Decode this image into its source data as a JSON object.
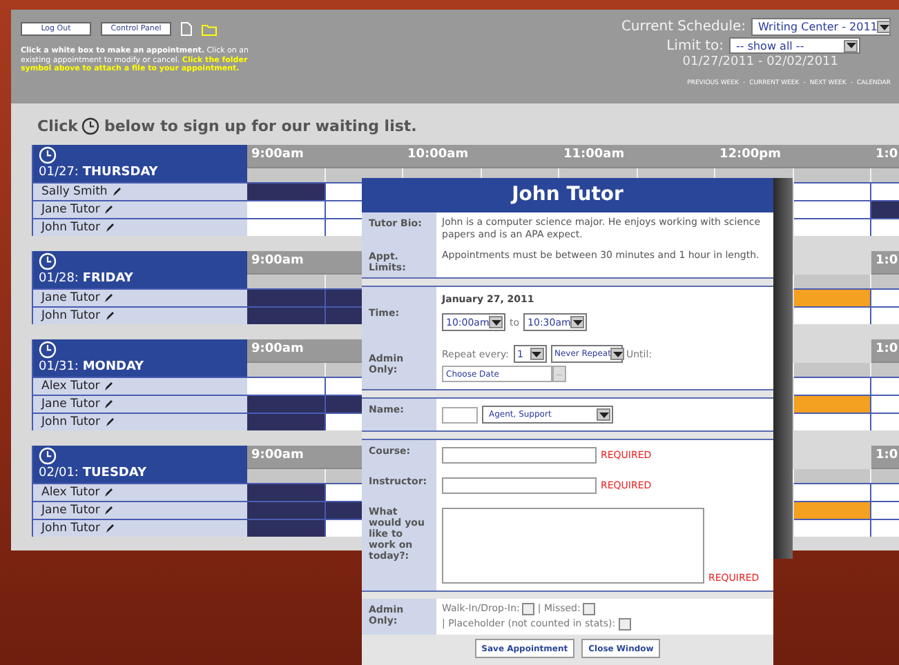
{
  "header": {
    "buttons": [
      "Log Out",
      "Control Panel"
    ],
    "instructions": "**Click a white box to make an appointment.** Click on an existing appointment to modify or cancel. **Click the folder symbol above to attach a file to your appointment.**",
    "schedule_label": "Current Schedule:",
    "schedule_value": "Writing Center - 2011",
    "limit_label": "Limit to:",
    "limit_value": "-- show all --",
    "date_range": "01/27/2011 - 02/02/2011",
    "links": [
      "PREVIOUS WEEK",
      "CURRENT WEEK",
      "NEXT WEEK",
      "CALENDAR"
    ],
    "link_separator": "-"
  },
  "waitlist": {
    "before": "Click",
    "after": "below to sign up for our waiting list."
  },
  "days": [
    {
      "title": "01/27: **THURSDAY**",
      "hours": [
        "9:00am",
        "10:00am",
        "11:00am",
        "12:00pm",
        "1:0"
      ],
      "tutors": [
        {
          "name": "Sally Smith",
          "slots_left": [
            {
              "color": "#2d2f5e"
            },
            {
              "color": "#ffffff"
            }
          ],
          "slots_right": [
            {
              "color": "#ffffff"
            },
            {
              "color": "#ffffff"
            }
          ]
        },
        {
          "name": "Jane Tutor",
          "slots_left": [
            {
              "color": "#ffffff"
            },
            {
              "color": "#ffffff"
            }
          ],
          "slots_right": [
            {
              "color": "#ffffff"
            },
            {
              "color": "#2d2f5e"
            }
          ]
        },
        {
          "name": "John Tutor",
          "slots_left": [
            {
              "color": "#ffffff"
            },
            {
              "color": "#ffffff"
            }
          ],
          "slots_right": [
            {
              "color": "#ffffff"
            },
            {
              "color": "#ffffff"
            }
          ]
        }
      ]
    },
    {
      "title": "01/28: **FRIDAY**",
      "hours": [
        "9:00am",
        "1:0"
      ],
      "tutors": [
        {
          "name": "Jane Tutor",
          "slots_left": [
            {
              "color": "#2d2f5e"
            },
            {
              "color": "#2d2f5e"
            }
          ],
          "slots_right": [
            {
              "color": "#f4a020"
            },
            {
              "color": "#ffffff"
            }
          ]
        },
        {
          "name": "John Tutor",
          "slots_left": [
            {
              "color": "#2d2f5e"
            },
            {
              "color": "#2d2f5e"
            }
          ],
          "slots_right": [
            {
              "color": "#ffffff"
            },
            {
              "color": "#ffffff"
            }
          ]
        }
      ]
    },
    {
      "title": "01/31: **MONDAY**",
      "hours": [
        "9:00am",
        "1:0"
      ],
      "tutors": [
        {
          "name": "Alex Tutor",
          "slots_left": [
            {
              "color": "#ffffff"
            },
            {
              "color": "#ffffff"
            }
          ],
          "slots_right": [
            {
              "color": "#ffffff"
            },
            {
              "color": "#ffffff"
            }
          ]
        },
        {
          "name": "Jane Tutor",
          "slots_left": [
            {
              "color": "#2d2f5e"
            },
            {
              "color": "#2d2f5e"
            }
          ],
          "slots_right": [
            {
              "color": "#f4a020"
            },
            {
              "color": "#ffffff"
            }
          ]
        },
        {
          "name": "John Tutor",
          "slots_left": [
            {
              "color": "#2d2f5e"
            },
            {
              "color": "#ffffff"
            }
          ],
          "slots_right": [
            {
              "color": "#ffffff"
            },
            {
              "color": "#ffffff"
            }
          ]
        }
      ]
    },
    {
      "title": "02/01: **TUESDAY**",
      "hours": [
        "9:00am",
        "1:0"
      ],
      "tutors": [
        {
          "name": "Alex Tutor",
          "slots_left": [
            {
              "color": "#2d2f5e"
            },
            {
              "color": "#ffffff"
            }
          ],
          "slots_right": [
            {
              "color": "#ffffff"
            },
            {
              "color": "#ffffff"
            }
          ]
        },
        {
          "name": "Jane Tutor",
          "slots_left": [
            {
              "color": "#2d2f5e"
            },
            {
              "color": "#2d2f5e"
            }
          ],
          "slots_right": [
            {
              "color": "#f4a020"
            },
            {
              "color": "#ffffff"
            }
          ]
        },
        {
          "name": "John Tutor",
          "slots_left": [
            {
              "color": "#2d2f5e"
            },
            {
              "color": "#ffffff"
            }
          ],
          "slots_right": [
            {
              "color": "#ffffff"
            },
            {
              "color": "#ffffff"
            }
          ]
        }
      ]
    }
  ],
  "popup": {
    "title": "John Tutor",
    "bio_label": "Tutor Bio:",
    "bio": "John is a computer science major. He enjoys working with science papers and is an APA expect.",
    "limits_label": "Appt. Limits:",
    "limits": "Appointments must be between 30 minutes and 1 hour in length.",
    "time_label": "Time:",
    "date": "January 27, 2011",
    "start": "10:00am",
    "to": "to",
    "end": "10:30am",
    "admin_label": "Admin Only:",
    "repeat_label": "Repeat every:",
    "repeat_value": "1",
    "repeat_mode": "Never Repeat",
    "until_label": "Until:",
    "until_placeholder": "Choose Date",
    "date_button": "...",
    "name_label": "Name:",
    "name_value": "Agent, Support",
    "fields": [
      {
        "kind": "line",
        "label": "Course:",
        "note": "REQUIRED"
      },
      {
        "kind": "line",
        "label": "Instructor:",
        "note": "REQUIRED"
      },
      {
        "kind": "area",
        "label": "What would you like to work on today?:",
        "note": "REQUIRED"
      }
    ],
    "flags_label": "Admin Only:",
    "flags": [
      {
        "label": "Walk-In/Drop-In:",
        "checked": false
      },
      {
        "label": "| Missed:",
        "checked": false
      },
      {
        "label": "| Placeholder (not counted in stats):",
        "checked": false
      }
    ],
    "buttons": [
      "Save Appointment",
      "Close Window"
    ]
  }
}
